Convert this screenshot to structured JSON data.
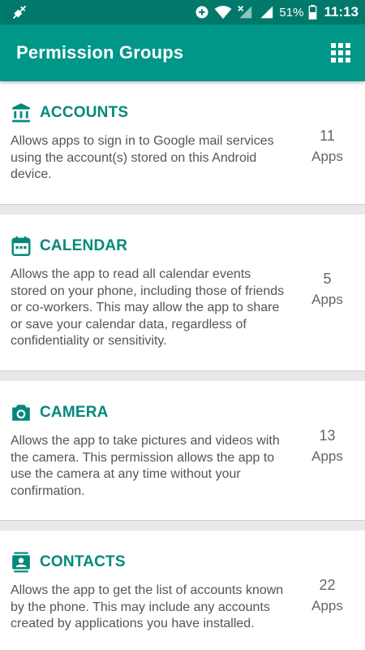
{
  "status_bar": {
    "battery_percent": "51%",
    "time": "11:13"
  },
  "app_bar": {
    "title": "Permission Groups",
    "menu_icon": "grid-icon"
  },
  "colors": {
    "status_bar": "#00796b",
    "app_bar": "#009688",
    "accent": "#00897b"
  },
  "groups": [
    {
      "icon": "bank-icon",
      "title": "ACCOUNTS",
      "description": "Allows apps to sign in to Google mail services using the account(s) stored on this Android device.",
      "count": "11",
      "unit": "Apps"
    },
    {
      "icon": "calendar-icon",
      "title": "CALENDAR",
      "description": "Allows the app to read all calendar events stored on your phone, including those of friends or co-workers. This may allow the app to share or save your calendar data, regardless of confidentiality or sensitivity.",
      "count": "5",
      "unit": "Apps"
    },
    {
      "icon": "camera-icon",
      "title": "CAMERA",
      "description": "Allows the app to take pictures and videos with the camera. This permission allows the app to use the camera at any time without your confirmation.",
      "count": "13",
      "unit": "Apps"
    },
    {
      "icon": "contacts-icon",
      "title": "CONTACTS",
      "description": "Allows the app to get the list of accounts known by the phone. This may include any accounts created by applications you have installed.",
      "count": "22",
      "unit": "Apps"
    }
  ]
}
